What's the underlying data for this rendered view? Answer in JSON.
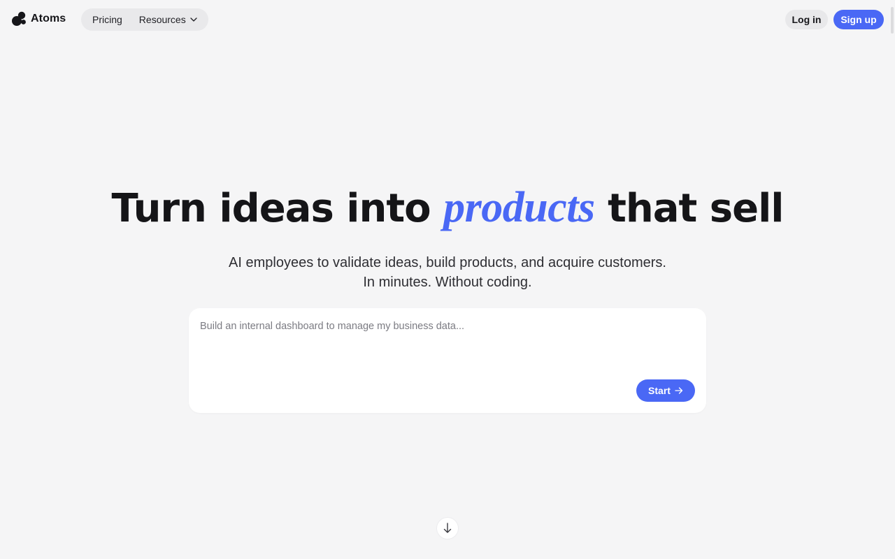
{
  "header": {
    "brand": "Atoms",
    "nav": {
      "pricing": "Pricing",
      "resources": "Resources"
    },
    "login_label": "Log in",
    "signup_label": "Sign up"
  },
  "hero": {
    "title_before": "Turn ideas into ",
    "title_accent": "products",
    "title_after": " that sell",
    "subtitle_line1": "AI employees to validate ideas, build products, and acquire customers.",
    "subtitle_line2": "In minutes. Without coding."
  },
  "prompt": {
    "placeholder": "Build an internal dashboard to manage my business data...",
    "value": "",
    "start_label": "Start"
  },
  "icons": {
    "logo": "atoms-logo-icon",
    "resources_chevron": "chevron-down-icon",
    "start_arrow": "arrow-right-icon",
    "scroll_down": "arrow-down-icon"
  },
  "colors": {
    "accent": "#4a68f5",
    "background": "#f5f5f6",
    "text": "#16161a"
  }
}
